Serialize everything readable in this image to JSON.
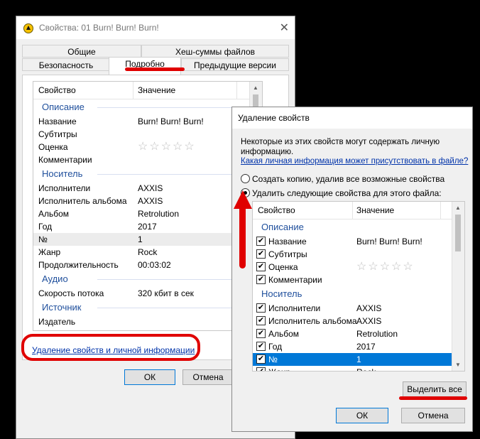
{
  "props_window": {
    "title": "Свойства: 01 Burn! Burn! Burn!",
    "tabs_row1": [
      "Общие",
      "Хеш-суммы файлов"
    ],
    "tabs_row2": [
      "Безопасность",
      "Подробно",
      "Предыдущие версии"
    ],
    "active_tab": "Подробно",
    "columns": [
      "Свойство",
      "Значение"
    ],
    "groups": [
      {
        "name": "Описание",
        "rows": [
          {
            "property": "Название",
            "value": "Burn! Burn! Burn!"
          },
          {
            "property": "Субтитры",
            "value": ""
          },
          {
            "property": "Оценка",
            "value": "☆☆☆☆☆"
          },
          {
            "property": "Комментарии",
            "value": ""
          }
        ]
      },
      {
        "name": "Носитель",
        "rows": [
          {
            "property": "Исполнители",
            "value": "AXXIS"
          },
          {
            "property": "Исполнитель альбома",
            "value": "AXXIS"
          },
          {
            "property": "Альбом",
            "value": "Retrolution"
          },
          {
            "property": "Год",
            "value": "2017"
          },
          {
            "property": "№",
            "value": "1"
          },
          {
            "property": "Жанр",
            "value": "Rock"
          },
          {
            "property": "Продолжительность",
            "value": "00:03:02"
          }
        ]
      },
      {
        "name": "Аудио",
        "rows": [
          {
            "property": "Скорость потока",
            "value": "320 кбит в сек"
          }
        ]
      },
      {
        "name": "Источник",
        "rows": [
          {
            "property": "Издатель",
            "value": ""
          }
        ]
      }
    ],
    "remove_link": "Удаление свойств и личной информации",
    "ok": "ОК",
    "cancel": "Отмена"
  },
  "remove_dialog": {
    "title": "Удаление свойств",
    "description": "Некоторые из этих свойств могут содержать личную информацию.",
    "privacy_link": "Какая личная информация может присутствовать в файле?",
    "option_copy": "Создать копию, удалив все возможные свойства",
    "option_remove": "Удалить следующие свойства для этого файла:",
    "selected_option": "option_remove",
    "columns": [
      "Свойство",
      "Значение"
    ],
    "groups": [
      {
        "name": "Описание",
        "rows": [
          {
            "property": "Название",
            "value": "Burn! Burn! Burn!",
            "checked": true
          },
          {
            "property": "Субтитры",
            "value": "",
            "checked": true
          },
          {
            "property": "Оценка",
            "value": "☆☆☆☆☆",
            "checked": true
          },
          {
            "property": "Комментарии",
            "value": "",
            "checked": true
          }
        ]
      },
      {
        "name": "Носитель",
        "rows": [
          {
            "property": "Исполнители",
            "value": "AXXIS",
            "checked": true
          },
          {
            "property": "Исполнитель альбома",
            "value": "AXXIS",
            "checked": true
          },
          {
            "property": "Альбом",
            "value": "Retrolution",
            "checked": true
          },
          {
            "property": "Год",
            "value": "2017",
            "checked": true
          },
          {
            "property": "№",
            "value": "1",
            "checked": true,
            "selected": true
          },
          {
            "property": "Жанр",
            "value": "Rock",
            "checked": true
          }
        ]
      }
    ],
    "select_all": "Выделить все",
    "ok": "ОК",
    "cancel": "Отмена"
  },
  "colors": {
    "accent": "#0078d7",
    "annotation_red": "#e00000",
    "group_header": "#1f4f9c"
  }
}
